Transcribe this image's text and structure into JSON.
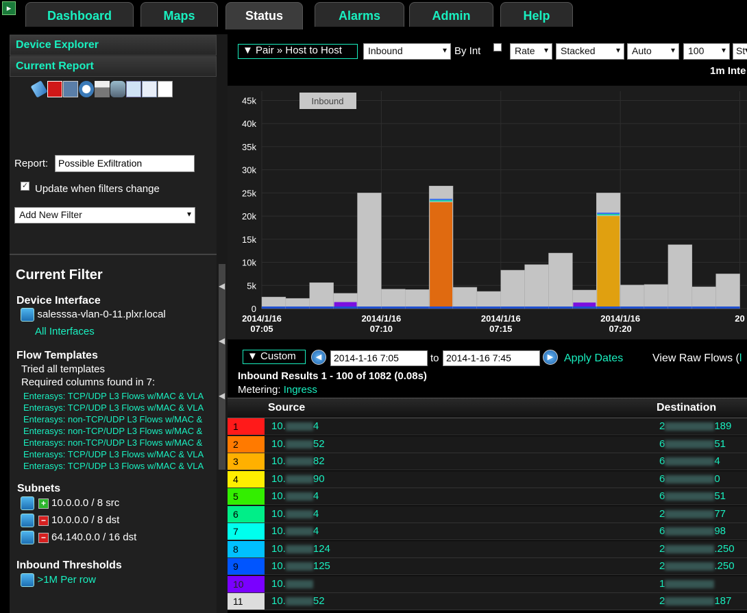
{
  "tabs": [
    {
      "label": "Dashboard",
      "active": false
    },
    {
      "label": "Maps",
      "active": false
    },
    {
      "label": "Status",
      "active": true
    },
    {
      "label": "Alarms",
      "active": false
    },
    {
      "label": "Admin",
      "active": false
    },
    {
      "label": "Help",
      "active": false
    }
  ],
  "left": {
    "device_explorer": "Device Explorer",
    "current_report": "Current Report",
    "report_label": "Report:",
    "report_value": "Possible Exfiltration",
    "update_label": "Update when filters change",
    "update_checked": true,
    "add_filter": "Add New Filter",
    "current_filter_title": "Current Filter",
    "device_interface_title": "Device Interface",
    "device_name": "salesssa-vlan-0-11.plxr.local",
    "all_interfaces": "All Interfaces",
    "flow_templates_title": "Flow Templates",
    "tried_templates": "Tried all templates",
    "required_columns": "Required columns found in 7:",
    "templates": [
      "Enterasys: TCP/UDP L3 Flows w/MAC & VLA",
      "Enterasys: TCP/UDP L3 Flows w/MAC & VLA",
      "Enterasys: non-TCP/UDP L3 Flows w/MAC &",
      "Enterasys: non-TCP/UDP L3 Flows w/MAC &",
      "Enterasys: non-TCP/UDP L3 Flows w/MAC &",
      "Enterasys: TCP/UDP L3 Flows w/MAC & VLA",
      "Enterasys: TCP/UDP L3 Flows w/MAC & VLA"
    ],
    "subnets_title": "Subnets",
    "subnets": [
      {
        "text": "10.0.0.0 / 8 src",
        "sign": "+"
      },
      {
        "text": "10.0.0.0 / 8 dst",
        "sign": "-"
      },
      {
        "text": "64.140.0.0 / 16 dst",
        "sign": "-"
      }
    ],
    "thresholds_title": "Inbound Thresholds",
    "threshold": ">1M Per row"
  },
  "toolbar": {
    "pair": "▼ Pair » Host to Host",
    "direction": "Inbound",
    "by_int": "By Int",
    "rate": "Rate",
    "stacked": "Stacked",
    "auto": "Auto",
    "count": "100",
    "st": "St",
    "interval": "1m Inte"
  },
  "chart_data": {
    "type": "bar",
    "stacked": true,
    "legend_tag": "Inbound",
    "y_ticks": [
      "0",
      "5k",
      "10k",
      "15k",
      "20k",
      "25k",
      "30k",
      "35k",
      "40k",
      "45k"
    ],
    "ylim": [
      0,
      47000
    ],
    "x_tick_labels": [
      [
        "2014/1/16",
        "07:05"
      ],
      [
        "2014/1/16",
        "07:10"
      ],
      [
        "2014/1/16",
        "07:15"
      ],
      [
        "2014/1/16",
        "07:20"
      ],
      [
        "20",
        ""
      ]
    ],
    "bars": [
      {
        "total": 2500,
        "color_val": 0,
        "color": null
      },
      {
        "total": 2200,
        "color_val": 0,
        "color": null
      },
      {
        "total": 5600,
        "color_val": 0,
        "color": null
      },
      {
        "total": 3300,
        "color_val": 1400,
        "color": "#7a10e0"
      },
      {
        "total": 25000,
        "color_val": 0,
        "color": null
      },
      {
        "total": 4200,
        "color_val": 0,
        "color": null
      },
      {
        "total": 4100,
        "color_val": 0,
        "color": null
      },
      {
        "total": 26500,
        "color_val": 23000,
        "color": "#e06a10"
      },
      {
        "total": 4600,
        "color_val": 0,
        "color": null
      },
      {
        "total": 3700,
        "color_val": 0,
        "color": null
      },
      {
        "total": 8300,
        "color_val": 0,
        "color": null
      },
      {
        "total": 9500,
        "color_val": 0,
        "color": null
      },
      {
        "total": 12000,
        "color_val": 0,
        "color": null
      },
      {
        "total": 4000,
        "color_val": 1300,
        "color": "#7a10e0"
      },
      {
        "total": 25000,
        "color_val": 20000,
        "color": "#e0a010"
      },
      {
        "total": 5100,
        "color_val": 0,
        "color": null
      },
      {
        "total": 5200,
        "color_val": 0,
        "color": null
      },
      {
        "total": 13800,
        "color_val": 0,
        "color": null
      },
      {
        "total": 4700,
        "color_val": 0,
        "color": null
      },
      {
        "total": 7500,
        "color_val": 0,
        "color": null
      }
    ]
  },
  "dates": {
    "custom": "▼ Custom",
    "from": "2014-1-16 7:05",
    "to_label": "to",
    "to": "2014-1-16 7:45",
    "apply": "Apply Dates",
    "raw": "View Raw Flows ("
  },
  "results": {
    "title": "Inbound Results 1 - 100 of 1082 (0.08s)",
    "metering_label": "Metering:",
    "metering_value": "Ingress",
    "col_source": "Source",
    "col_destination": "Destination",
    "rows": [
      {
        "rank": "1",
        "color": "#ff1a1a",
        "src_a": "10.",
        "src_b": "4",
        "dst_a": "2",
        "dst_b": "189"
      },
      {
        "rank": "2",
        "color": "#ff7a00",
        "src_a": "10.",
        "src_b": "52",
        "dst_a": "6",
        "dst_b": "51"
      },
      {
        "rank": "3",
        "color": "#ffb000",
        "src_a": "10.",
        "src_b": "82",
        "dst_a": "6",
        "dst_b": "4"
      },
      {
        "rank": "4",
        "color": "#ffee00",
        "src_a": "10.",
        "src_b": "90",
        "dst_a": "6",
        "dst_b": "0"
      },
      {
        "rank": "5",
        "color": "#33ee00",
        "src_a": "10.",
        "src_b": "4",
        "dst_a": "6",
        "dst_b": "51"
      },
      {
        "rank": "6",
        "color": "#00ee88",
        "src_a": "10.",
        "src_b": "4",
        "dst_a": "2",
        "dst_b": "77"
      },
      {
        "rank": "7",
        "color": "#00ffee",
        "src_a": "10.",
        "src_b": "4",
        "dst_a": "6",
        "dst_b": "98"
      },
      {
        "rank": "8",
        "color": "#00c0ff",
        "src_a": "10.",
        "src_b": "124",
        "dst_a": "2",
        "dst_b": ".250"
      },
      {
        "rank": "9",
        "color": "#0055ff",
        "src_a": "10.",
        "src_b": "125",
        "dst_a": "2",
        "dst_b": ".250"
      },
      {
        "rank": "10",
        "color": "#7a00ff",
        "src_a": "10.",
        "src_b": "",
        "dst_a": "1",
        "dst_b": ""
      },
      {
        "rank": "11",
        "color": "#dddddd",
        "src_a": "10.",
        "src_b": "52",
        "dst_a": "2",
        "dst_b": "187"
      }
    ]
  }
}
